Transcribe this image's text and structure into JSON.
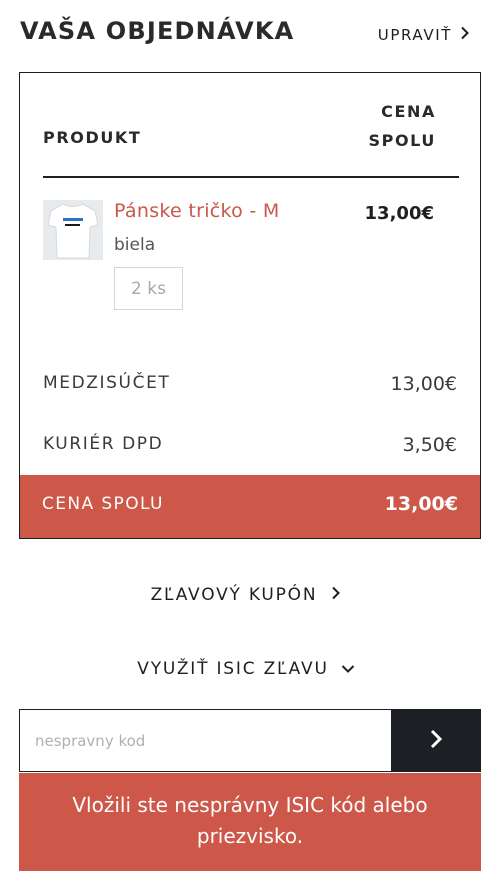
{
  "header": {
    "title": "VAŠA OBJEDNÁVKA",
    "edit_label": "UPRAVIŤ"
  },
  "table": {
    "col_product": "PRODUKT",
    "col_total_line1": "CENA",
    "col_total_line2": "SPOLU"
  },
  "product": {
    "name": "Pánske tričko - M",
    "price": "13,00€",
    "color": "biela",
    "quantity": "2 ks",
    "thumbnail_text": "ATHLETIC TEAM"
  },
  "summary": {
    "subtotal_label": "MEDZISÚČET",
    "subtotal_value": "13,00€",
    "shipping_label": "KURIÉR DPD",
    "shipping_value": "3,50€",
    "total_label": "CENA SPOLU",
    "total_value": "13,00€"
  },
  "coupon": {
    "label": "ZĽAVOVÝ KUPÓN"
  },
  "isic": {
    "label": "VYUŽIŤ ISIC ZĽAVU",
    "placeholder": "nespravny kod",
    "error": "Vložili ste nesprávny ISIC kód alebo priezvisko."
  },
  "colors": {
    "accent": "#cd5849",
    "dark_button": "#1c1f24",
    "text": "#1f1f1f"
  },
  "icons": {
    "edit": "chevron-right-icon",
    "coupon": "chevron-right-icon",
    "isic": "chevron-down-icon",
    "submit": "chevron-right-icon"
  }
}
